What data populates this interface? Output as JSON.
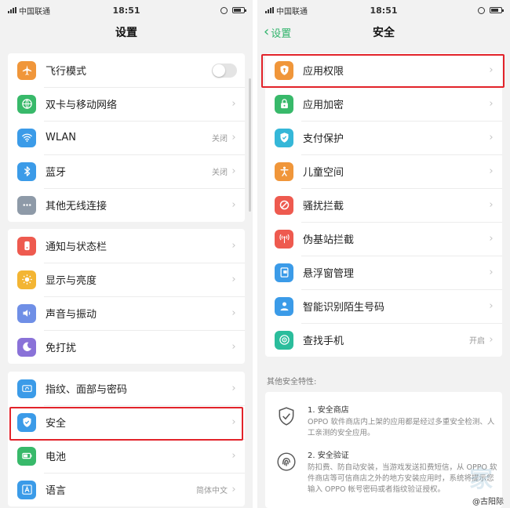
{
  "left": {
    "status": {
      "carrier": "中国联通",
      "time": "18:51"
    },
    "title": "设置",
    "groups": [
      [
        {
          "label": "飞行模式",
          "icon": "airplane-icon",
          "color": "#f0963a",
          "control": "toggle"
        },
        {
          "label": "双卡与移动网络",
          "icon": "globe-icon",
          "color": "#38b96a"
        },
        {
          "label": "WLAN",
          "icon": "wifi-icon",
          "color": "#3b9be8",
          "value": "关闭"
        },
        {
          "label": "蓝牙",
          "icon": "bluetooth-icon",
          "color": "#3b9be8",
          "value": "关闭"
        },
        {
          "label": "其他无线连接",
          "icon": "more-dots-icon",
          "color": "#8e9aa8"
        }
      ],
      [
        {
          "label": "通知与状态栏",
          "icon": "notification-icon",
          "color": "#ee5a4f"
        },
        {
          "label": "显示与亮度",
          "icon": "brightness-icon",
          "color": "#f3b533"
        },
        {
          "label": "声音与振动",
          "icon": "speaker-icon",
          "color": "#6f8fe6"
        },
        {
          "label": "免打扰",
          "icon": "moon-icon",
          "color": "#8a72d8"
        }
      ],
      [
        {
          "label": "指纹、面部与密码",
          "icon": "fingerprint-icon",
          "color": "#3b9be8"
        },
        {
          "label": "安全",
          "icon": "shield-icon",
          "color": "#3b9be8"
        },
        {
          "label": "电池",
          "icon": "battery-icon",
          "color": "#38b96a"
        },
        {
          "label": "语言",
          "icon": "language-icon",
          "color": "#3b9be8",
          "value": "简体中文"
        }
      ]
    ]
  },
  "right": {
    "status": {
      "carrier": "中国联通",
      "time": "18:51"
    },
    "back_label": "设置",
    "title": "安全",
    "items": [
      {
        "label": "应用权限",
        "icon": "permission-shield-icon",
        "color": "#f0963a"
      },
      {
        "label": "应用加密",
        "icon": "lock-icon",
        "color": "#38b96a"
      },
      {
        "label": "支付保护",
        "icon": "payment-shield-icon",
        "color": "#35b7d8"
      },
      {
        "label": "儿童空间",
        "icon": "child-icon",
        "color": "#f0963a"
      },
      {
        "label": "骚扰拦截",
        "icon": "block-icon",
        "color": "#ee5a4f"
      },
      {
        "label": "伪基站拦截",
        "icon": "antenna-icon",
        "color": "#ee5a4f"
      },
      {
        "label": "悬浮窗管理",
        "icon": "floating-window-icon",
        "color": "#3b9be8"
      },
      {
        "label": "智能识别陌生号码",
        "icon": "contact-icon",
        "color": "#3b9be8"
      },
      {
        "label": "查找手机",
        "icon": "find-phone-icon",
        "color": "#2bbd9c",
        "value": "开启"
      }
    ],
    "section_title": "其他安全特性:",
    "features": [
      {
        "title": "1. 安全商店",
        "desc": "OPPO 软件商店内上架的应用都是经过多重安全检测、人工亲测的安全应用。",
        "icon": "shield-check-outline-icon"
      },
      {
        "title": "2. 安全验证",
        "desc": "防扣费、防自动安装，当游戏发送扣费短信，从 OPPO 软件商店等可信商店之外的地方安装应用时，系统将提示您输入 OPPO 帐号密码或者指纹验证授权。",
        "icon": "fingerprint-outline-icon"
      }
    ]
  },
  "watermark": "@古阳际",
  "watermark_bg": "家"
}
